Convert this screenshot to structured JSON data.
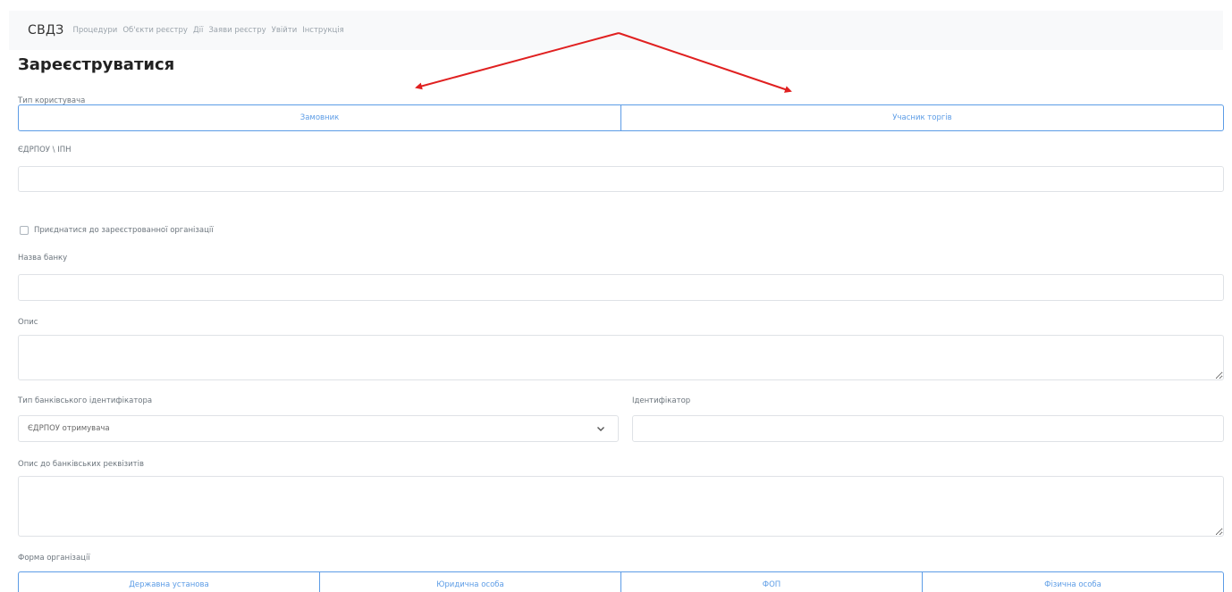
{
  "navbar": {
    "brand": "СВДЗ",
    "items": [
      "Процедури",
      "Об'єкти реєстру",
      "Дії",
      "Заяви реєстру",
      "Увійти",
      "Інструкція"
    ]
  },
  "page": {
    "title": "Зареєструватися"
  },
  "user_type": {
    "label": "Тип користувача",
    "options": [
      "Замовник",
      "Учасник торгів"
    ]
  },
  "edrpou": {
    "label": "ЄДРПОУ \\ ІПН",
    "value": ""
  },
  "join_org": {
    "label": "Приєднатися до зареєстрованної організації",
    "checked": false
  },
  "bank_name": {
    "label": "Назва банку",
    "value": ""
  },
  "description": {
    "label": "Опис",
    "value": ""
  },
  "bank_id_type": {
    "label": "Тип банківського ідентифікатора",
    "selected": "ЄДРПОУ отримувача"
  },
  "identifier": {
    "label": "Ідентифікатор",
    "value": ""
  },
  "bank_details_description": {
    "label": "Опис до банківських реквізитів",
    "value": ""
  },
  "org_form": {
    "label": "Форма організації",
    "options": [
      "Державна установа",
      "Юридична особа",
      "ФОП",
      "Фізична особа"
    ]
  },
  "colors": {
    "accent": "#5c9ce6",
    "arrow": "#e02020",
    "navbar_bg": "#f8f9fa",
    "border": "#dfe2e6"
  },
  "icons": {
    "select_chevron": "chevron-down-icon",
    "textarea_resize": "resize-grip-icon"
  }
}
